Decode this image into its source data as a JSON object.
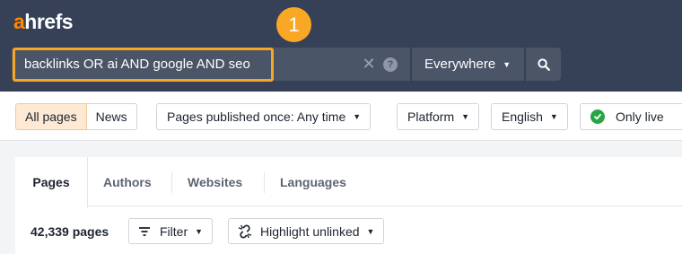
{
  "header": {
    "logo_a": "a",
    "logo_rest": "hrefs",
    "step_badge": "1",
    "search": {
      "value": "backlinks OR ai AND google AND seo",
      "placeholder": ""
    },
    "clear_icon": "close-icon",
    "help_icon": "question-circle-icon",
    "help_glyph": "?",
    "scope_selected": "Everywhere",
    "search_icon": "search-icon"
  },
  "filters": {
    "page_type": [
      "All pages",
      "News"
    ],
    "published": "Pages published once: Any time",
    "platform": "Platform",
    "language": "English",
    "live": "Only live"
  },
  "tabs": [
    "Pages",
    "Authors",
    "Websites",
    "Languages"
  ],
  "results": {
    "count": "42,339 pages",
    "filter_label": "Filter",
    "highlight_label": "Highlight unlinked"
  },
  "colors": {
    "header_bg": "#364056",
    "accent": "#ff8800",
    "badge": "#f9a825",
    "highlight": "#f5a623",
    "live_green": "#27a644"
  }
}
